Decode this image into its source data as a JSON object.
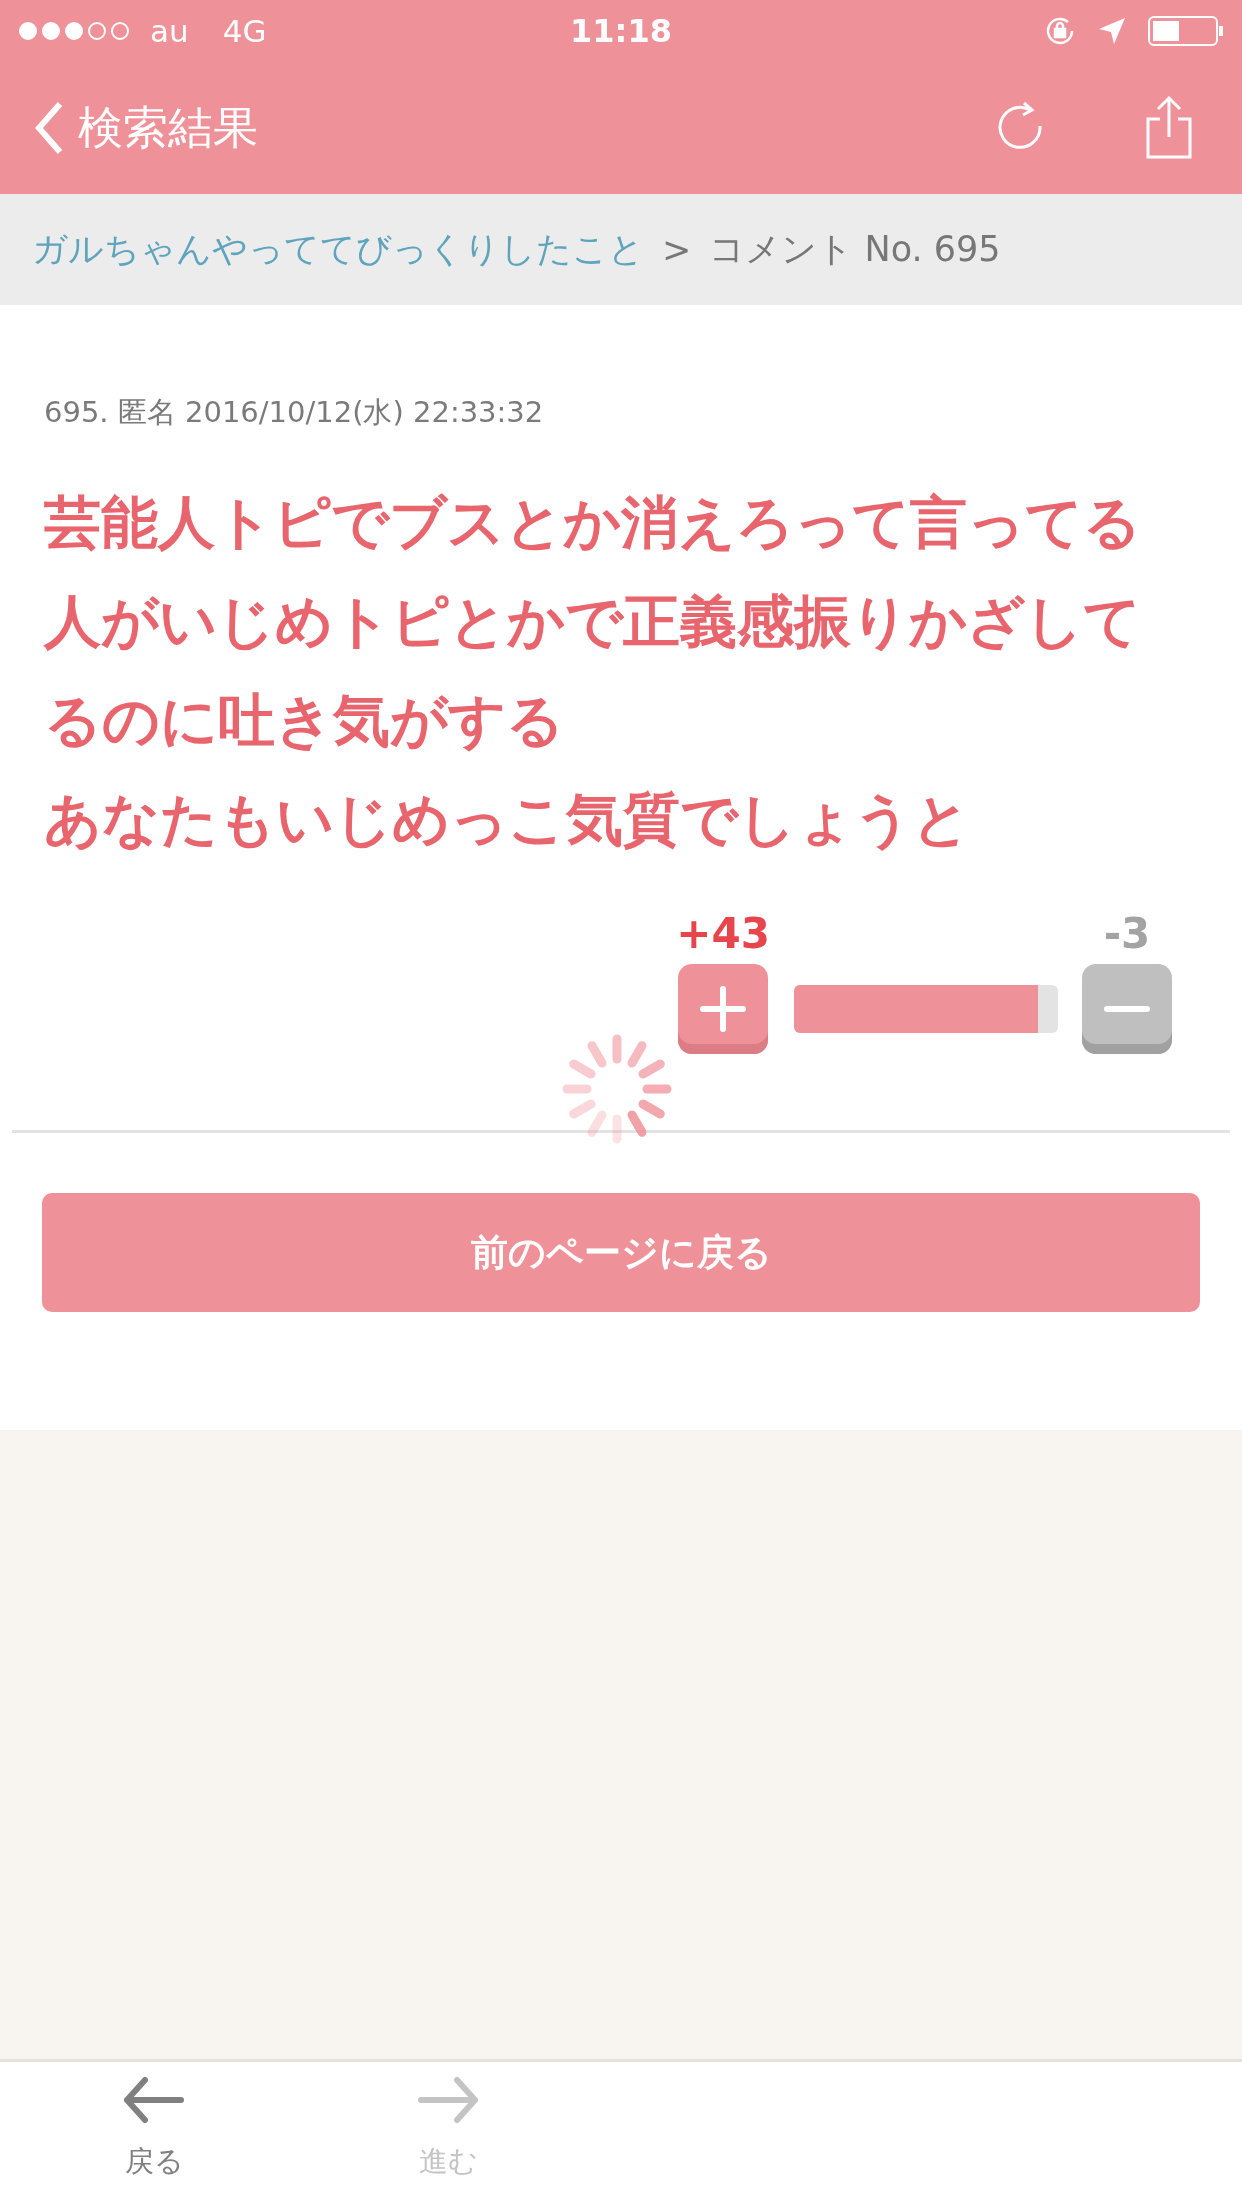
{
  "status_bar": {
    "carrier": "au",
    "network": "4G",
    "time": "11:18"
  },
  "nav_bar": {
    "back_label": "検索結果"
  },
  "breadcrumb": {
    "topic_link": "ガルちゃんやっててびっくりしたこと",
    "separator": ">",
    "current": "コメント No. 695"
  },
  "comment": {
    "meta": "695. 匿名 2016/10/12(水) 22:33:32",
    "body_lines": [
      "芸能人トピでブスとか消えろって言ってる",
      "人がいじめトピとかで正義感振りかざして",
      "るのに吐き気がする",
      "あなたもいじめっこ気質でしょうと"
    ],
    "votes": {
      "plus": "+43",
      "minus": "-3",
      "level": 0.924
    }
  },
  "back_button": {
    "label": "前のページに戻る"
  },
  "toolbar": {
    "items": [
      {
        "kind": "back",
        "label": "戻る",
        "disabled": false
      },
      {
        "kind": "forward",
        "label": "進む",
        "disabled": true
      }
    ]
  }
}
